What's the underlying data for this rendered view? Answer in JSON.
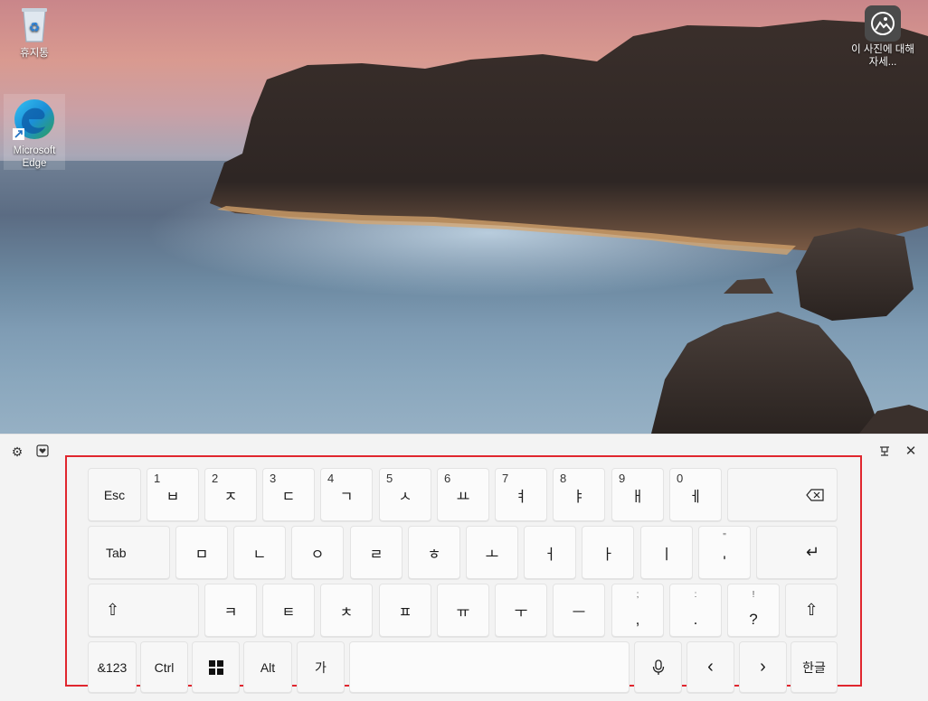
{
  "desktop": {
    "icons": [
      {
        "label": "휴지통",
        "icon": "recycle-bin-icon"
      },
      {
        "label": "Microsoft Edge",
        "icon": "edge-icon"
      },
      {
        "label": "이 사진에 대해 자세...",
        "icon": "learn-about-photo-icon"
      }
    ]
  },
  "keyboard": {
    "toolbar": {
      "settings_icon": "gear-icon",
      "emoji_icon": "heart-icon",
      "dock_icon": "dock-icon",
      "close_icon": "close-icon"
    },
    "row1": [
      {
        "label": "Esc"
      },
      {
        "sub": "1",
        "label": "ㅂ"
      },
      {
        "sub": "2",
        "label": "ㅈ"
      },
      {
        "sub": "3",
        "label": "ㄷ"
      },
      {
        "sub": "4",
        "label": "ㄱ"
      },
      {
        "sub": "5",
        "label": "ㅅ"
      },
      {
        "sub": "6",
        "label": "ㅛ"
      },
      {
        "sub": "7",
        "label": "ㅕ"
      },
      {
        "sub": "8",
        "label": "ㅑ"
      },
      {
        "sub": "9",
        "label": "ㅐ"
      },
      {
        "sub": "0",
        "label": "ㅔ"
      },
      {
        "label": "⌫",
        "icon": "backspace-icon"
      }
    ],
    "row2": [
      {
        "label": "Tab"
      },
      {
        "label": "ㅁ"
      },
      {
        "label": "ㄴ"
      },
      {
        "label": "ㅇ"
      },
      {
        "label": "ㄹ"
      },
      {
        "label": "ㅎ"
      },
      {
        "label": "ㅗ"
      },
      {
        "label": "ㅓ"
      },
      {
        "label": "ㅏ"
      },
      {
        "label": "ㅣ"
      },
      {
        "top": "\"",
        "label": "'"
      },
      {
        "label": "↵",
        "icon": "enter-icon"
      }
    ],
    "row3": [
      {
        "label": "⇧",
        "icon": "shift-icon"
      },
      {
        "label": "ㅋ"
      },
      {
        "label": "ㅌ"
      },
      {
        "label": "ㅊ"
      },
      {
        "label": "ㅍ"
      },
      {
        "label": "ㅠ"
      },
      {
        "label": "ㅜ"
      },
      {
        "label": "ㅡ"
      },
      {
        "top": ";",
        "label": ","
      },
      {
        "top": ":",
        "label": "."
      },
      {
        "top": "!",
        "label": "?"
      },
      {
        "label": "⇧",
        "icon": "shift-icon"
      }
    ],
    "row4": [
      {
        "label": "&123"
      },
      {
        "label": "Ctrl"
      },
      {
        "label": "",
        "icon": "windows-icon"
      },
      {
        "label": "Alt"
      },
      {
        "label": "가"
      },
      {
        "label": "",
        "icon": "space"
      },
      {
        "label": "",
        "icon": "microphone-icon"
      },
      {
        "label": "‹",
        "icon": "left-arrow-icon"
      },
      {
        "label": "›",
        "icon": "right-arrow-icon"
      },
      {
        "label": "한글"
      }
    ]
  },
  "colors": {
    "highlight": "#e0262e",
    "panel_bg": "#f3f3f3",
    "key_bg": "#fbfbfb"
  }
}
